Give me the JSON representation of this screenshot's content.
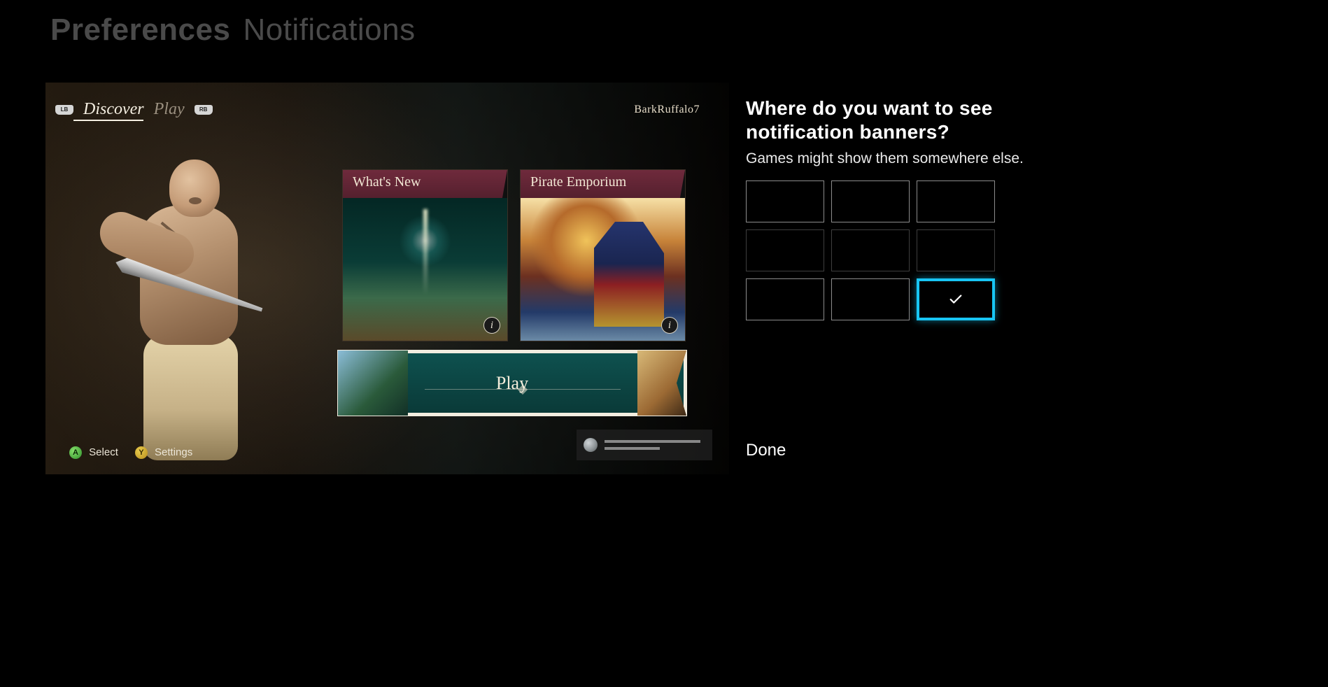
{
  "header": {
    "crumb_main": "Preferences",
    "crumb_sub": "Notifications"
  },
  "preview": {
    "lb_label": "LB",
    "rb_label": "RB",
    "tabs": {
      "discover": "Discover",
      "play": "Play"
    },
    "gamertag": "BarkRuffalo7",
    "tiles": {
      "whats_new": "What's New",
      "emporium": "Pirate Emporium"
    },
    "info_glyph": "i",
    "play_label": "Play",
    "hints": {
      "a_glyph": "A",
      "a_label": "Select",
      "y_glyph": "Y",
      "y_label": "Settings"
    }
  },
  "panel": {
    "heading": "Where do you want to see notification banners?",
    "subtext": "Games might show them somewhere else.",
    "selected_position": "bottom-right",
    "done_label": "Done"
  }
}
